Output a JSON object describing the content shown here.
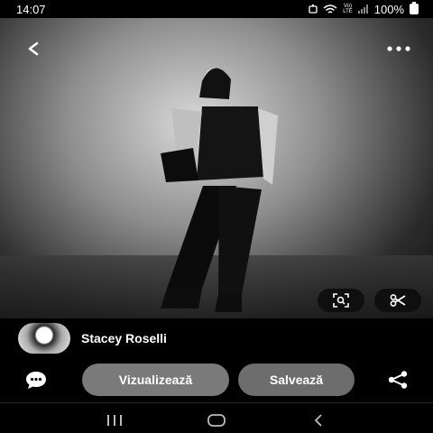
{
  "status_bar": {
    "time": "14:07",
    "volte_line1": "Vo)",
    "volte_line2": "LTE",
    "battery": "100%"
  },
  "photo": {
    "description_icon_names": [
      "back-arrow-icon",
      "more-dots-icon",
      "visual-search-icon",
      "scissors-icon"
    ]
  },
  "author": {
    "name": "Stacey Roselli"
  },
  "actions": {
    "visualize_label": "Vizualizează",
    "save_label": "Salvează"
  },
  "colors": {
    "background": "#000000",
    "button": "#7a7a7a",
    "save_button": "#6d6d6d"
  }
}
